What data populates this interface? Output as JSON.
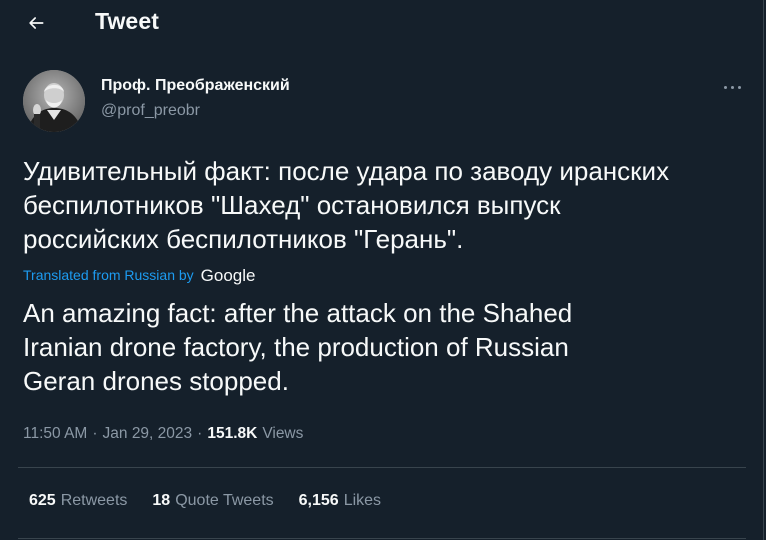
{
  "header": {
    "title": "Tweet",
    "back_icon": "arrow-left-icon"
  },
  "author": {
    "name": "Проф. Преображенский",
    "handle": "@prof_preobr",
    "avatar_icon": "profile-photo"
  },
  "tweet": {
    "text": "Удивительный факт: после удара по заводу иранских\nбеспилотников \"Шахед\" остановился выпуск\nроссийских беспилотников \"Герань\".",
    "translated_label": "Translated from Russian by",
    "translator": "Google",
    "translation": "An amazing fact: after the attack on the Shahed\nIranian drone factory, the production of Russian\nGeran drones stopped."
  },
  "meta": {
    "time": "11:50 AM",
    "separator": "·",
    "date": "Jan 29, 2023",
    "views_count": "151.8K",
    "views_label": "Views"
  },
  "stats": {
    "retweets_count": "625",
    "retweets_label": "Retweets",
    "quotes_count": "18",
    "quotes_label": "Quote Tweets",
    "likes_count": "6,156",
    "likes_label": "Likes"
  },
  "colors": {
    "background": "#15202b",
    "text": "#f7f9f9",
    "secondary": "#8b98a5",
    "accent": "#1d9bf0",
    "border": "#38444d"
  }
}
